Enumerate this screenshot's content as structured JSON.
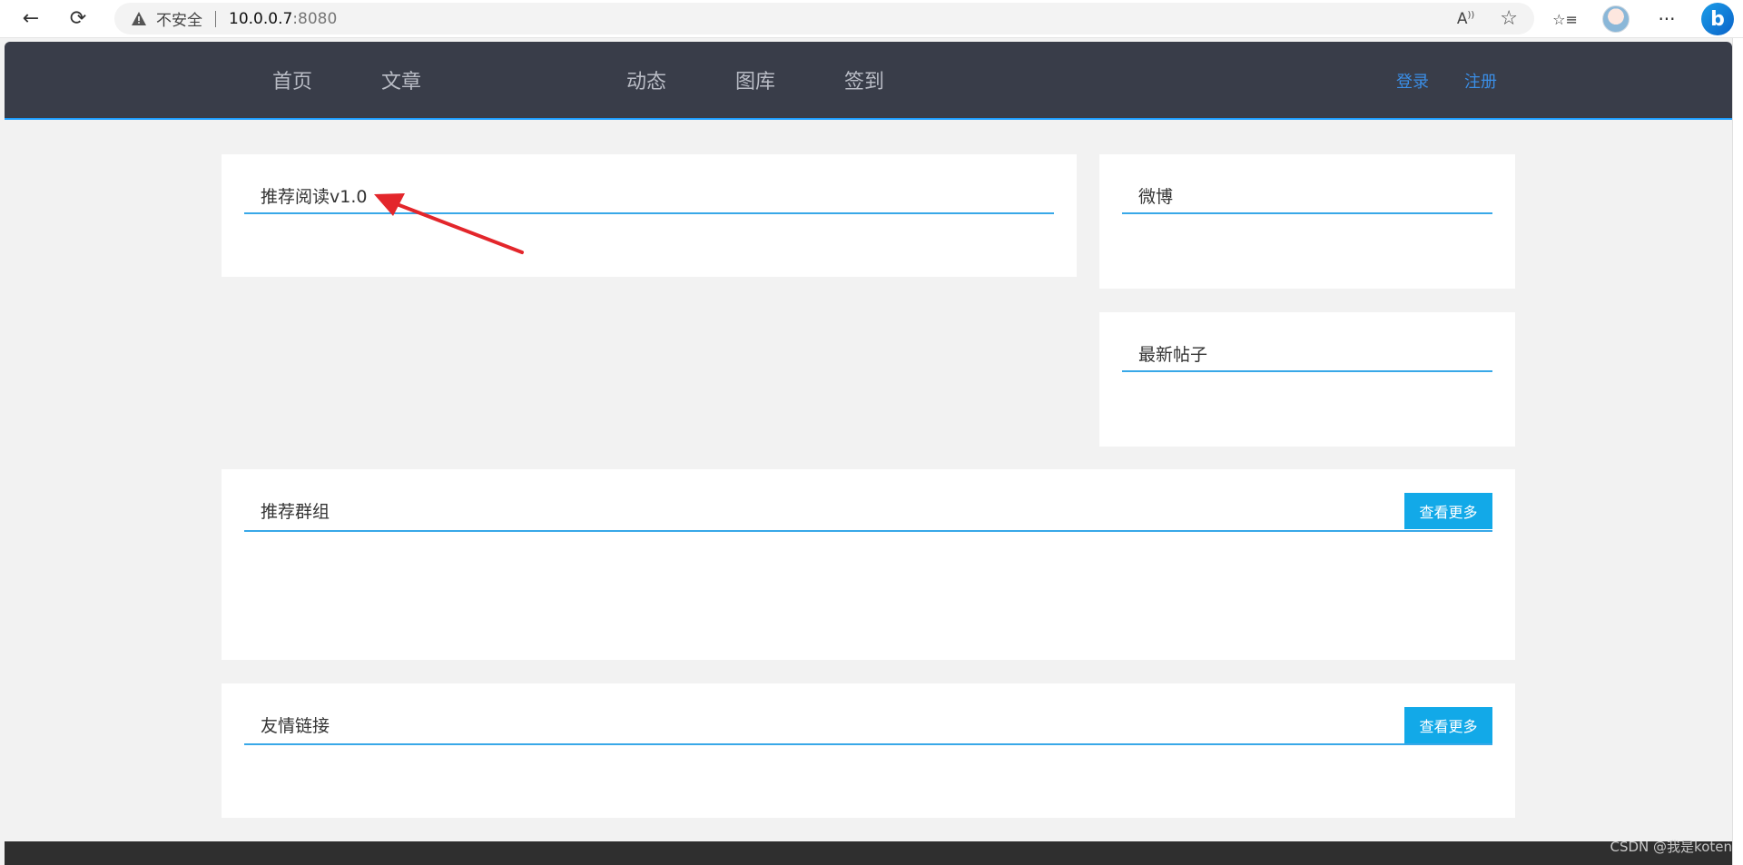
{
  "browser": {
    "back": "←",
    "reload": "⟳",
    "insecure_label": "不安全",
    "url_host": "10.0.0.7",
    "url_port": ":8080",
    "read_aloud": "A",
    "favorite": "☆",
    "favorites_list": "☆≡",
    "more": "···",
    "bing": "b"
  },
  "header": {
    "nav": [
      "首页",
      "文章",
      "动态",
      "图库",
      "签到"
    ],
    "login": "登录",
    "register": "注册"
  },
  "main": {
    "recommended_reading": {
      "title": "推荐阅读v1.0"
    },
    "weibo": {
      "title": "微博"
    },
    "latest_posts": {
      "title": "最新帖子"
    },
    "recommended_groups": {
      "title": "推荐群组",
      "more": "查看更多"
    },
    "friend_links": {
      "title": "友情链接",
      "more": "查看更多"
    }
  },
  "watermark": "CSDN @我是koten",
  "colors": {
    "header_bg": "#393d49",
    "accent_line": "#1e9fff",
    "more_button": "#12a9e8",
    "auth_link": "#3a8ee6",
    "annotation_arrow": "#e3262b"
  }
}
